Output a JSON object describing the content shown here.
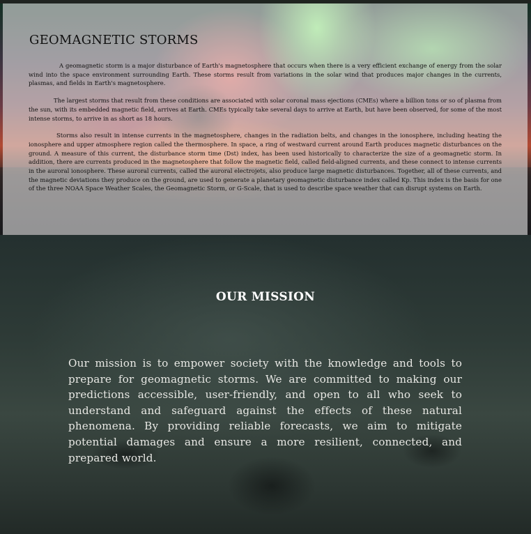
{
  "about": {
    "title": "GEOMAGNETIC STORMS",
    "paragraphs": [
      "A geomagnetic storm is a major disturbance of Earth's magnetosphere that occurs when there is a very efficient exchange of energy from the solar wind into the space environment surrounding Earth. These storms result from variations in the solar wind that produces major changes in the currents, plasmas, and fields in Earth's magnetosphere.",
      "The largest storms that result from these conditions are associated with solar coronal mass ejections (CMEs) where a billion tons or so of plasma from the sun, with its embedded magnetic field, arrives at Earth. CMEs typically take several days to arrive at Earth, but have been observed, for some of the most intense storms, to arrive in as short as 18 hours.",
      "Storms also result in intense currents in the magnetosphere, changes in the radiation belts, and changes in the ionosphere, including heating the ionosphere and upper atmosphere region called the thermosphere. In space, a ring of westward current around Earth produces magnetic disturbances on the ground. A measure of this current, the disturbance storm time (Dst) index, has been used historically to characterize the size of a geomagnetic storm. In addition, there are currents produced in the magnetosphere that follow the magnetic field, called field-aligned currents, and these connect to intense currents in the auroral ionosphere. These auroral currents, called the auroral electrojets, also produce large magnetic disturbances. Together, all of these currents, and the magnetic deviations they produce on the ground, are used to generate a planetary geomagnetic disturbance index called Kp. This index is the basis for one of the three NOAA Space Weather Scales, the Geomagnetic Storm, or G-Scale, that is used to describe space weather that can disrupt systems on Earth."
    ]
  },
  "mission": {
    "title": "OUR MISSION",
    "text": "Our mission is to empower society with the knowledge and tools to prepare for geomagnetic storms. We are committed to making our predictions accessible, user-friendly, and open to all who seek to understand and safeguard against the effects of these natural phenomena. By providing reliable forecasts, we aim to mitigate potential damages and ensure a more resilient, connected, and prepared world."
  }
}
